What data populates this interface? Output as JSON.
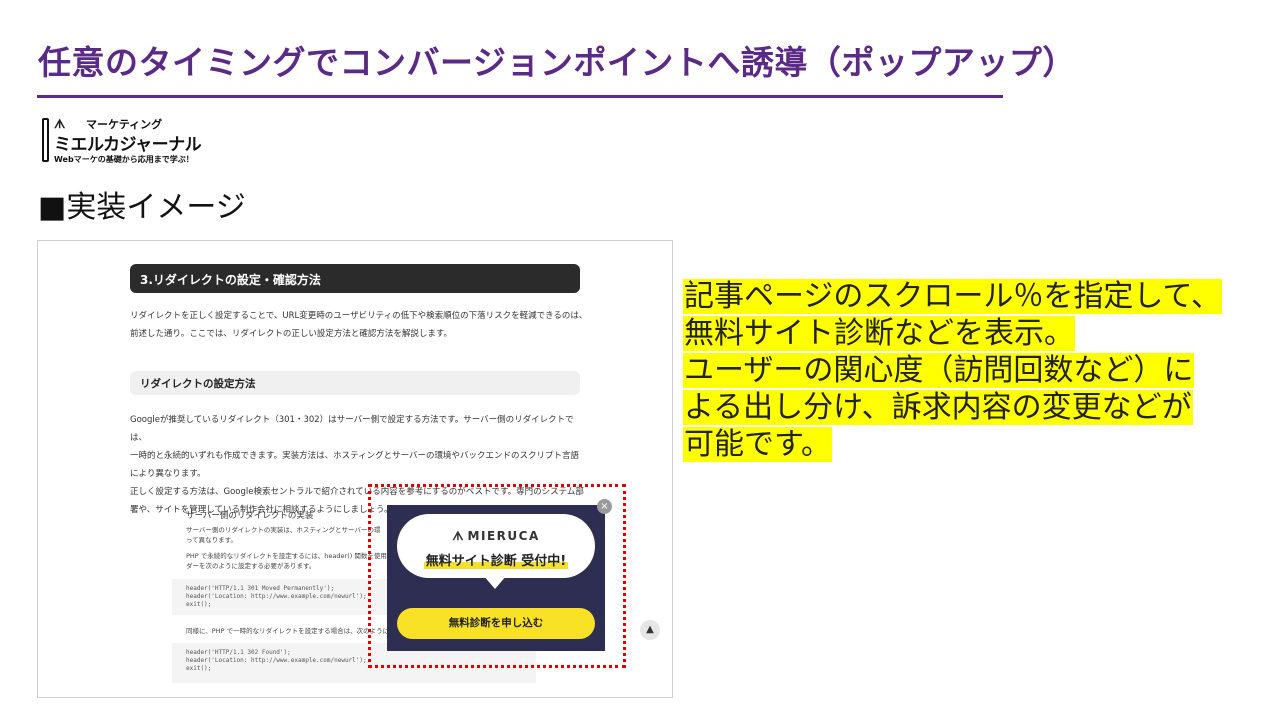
{
  "slide": {
    "title": "任意のタイミングでコンバージョンポイントへ誘導（ポップアップ）",
    "section_label": "■実装イメージ"
  },
  "logo": {
    "top_text": "マーケティング",
    "main_text": "ミエルカジャーナル",
    "tagline": "Webマーケの基礎から応用まで学ぶ！"
  },
  "article": {
    "section_heading": "3.リダイレクトの設定・確認方法",
    "intro_lines": [
      "リダイレクトを正しく設定することで、URL変更時のユーザビリティの低下や検索順位の下落リスクを軽減できるのは、",
      "前述した通り。ここでは、リダイレクトの正しい設定方法と確認方法を解説します。"
    ],
    "sub_heading": "リダイレクトの設定方法",
    "body_lines": [
      "Googleが推奨しているリダイレクト（301・302）はサーバー側で設定する方法です。サーバー側のリダイレクトでは、",
      "一時的と永続的いずれも作成できます。実装方法は、ホスティングとサーバーの環境やバックエンドのスクリプト言語",
      "により異なります。",
      "正しく設定する方法は、Google検索セントラルで紹介されている内容を参考にするのがベストです。専門のシステム部",
      "署や、サイトを管理している制作会社に相談するようにしましょう。"
    ],
    "box_title": "サーバー側のリダイレクトの実装",
    "box_lines": [
      "サーバー側のリダイレクトの実装は、ホスティングとサーバーの環",
      "って異なります。",
      "PHP で永続的なリダイレクトを設定するには、header() 関数を使用",
      "ダーを次のように設定する必要があります。"
    ],
    "code1": [
      "header('HTTP/1.1 301 Moved Permanently');",
      "header('Location: http://www.example.com/newurl');",
      "exit();"
    ],
    "next_note": "同様に、PHP で一時的なリダイレクトを設定する場合は、次のように",
    "code2": [
      "header('HTTP/1.1 302 Found');",
      "header('Location: http://www.example.com/newurl');",
      "exit();"
    ]
  },
  "popup": {
    "brand": "MIERUCA",
    "badge": "無料サイト診断 受付中!",
    "cta_label": "無料診断を申し込む",
    "close_glyph": "×",
    "to_top_glyph": "▲"
  },
  "note": {
    "lines": [
      "記事ページのスクロール％を指定して、",
      "無料サイト診断などを表示。",
      "ユーザーの関心度（訪問回数など）に",
      "よる出し分け、訴求内容の変更などが",
      "可能です。"
    ],
    "highlight_color": "#ffff00"
  },
  "colors": {
    "title": "#5b2a86",
    "popup_bg": "#2d2e52",
    "cta": "#f9e225",
    "frame": "#e00000"
  }
}
